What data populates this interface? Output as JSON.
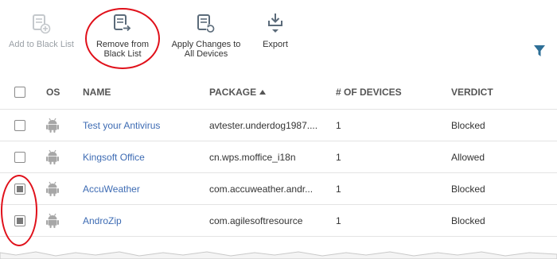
{
  "toolbar": {
    "add_label": "Add to Black List",
    "remove_label": "Remove from\nBlack List",
    "apply_label": "Apply Changes to\nAll Devices",
    "export_label": "Export"
  },
  "icons": {
    "add": "list-add-icon",
    "remove": "list-remove-icon",
    "apply": "list-refresh-icon",
    "export": "download-icon",
    "filter": "filter-funnel-icon",
    "os": "android-icon"
  },
  "table": {
    "headers": {
      "os": "OS",
      "name": "NAME",
      "package": "PACKAGE",
      "devices": "# OF DEVICES",
      "verdict": "VERDICT"
    },
    "rows": [
      {
        "name": "Test your Antivirus",
        "package": "avtester.underdog1987....",
        "devices": "1",
        "verdict": "Blocked",
        "checked": false
      },
      {
        "name": "Kingsoft Office",
        "package": "cn.wps.moffice_i18n",
        "devices": "1",
        "verdict": "Allowed",
        "checked": false
      },
      {
        "name": "AccuWeather",
        "package": "com.accuweather.andr...",
        "devices": "1",
        "verdict": "Blocked",
        "checked": true
      },
      {
        "name": "AndroZip",
        "package": "com.agilesoftresource",
        "devices": "1",
        "verdict": "Blocked",
        "checked": true
      }
    ]
  },
  "colors": {
    "link": "#3d6bb3",
    "highlight": "#e0101a",
    "icon": "#5b6b7a",
    "disabled": "#9aa0a6",
    "android": "#a7a7a7"
  }
}
